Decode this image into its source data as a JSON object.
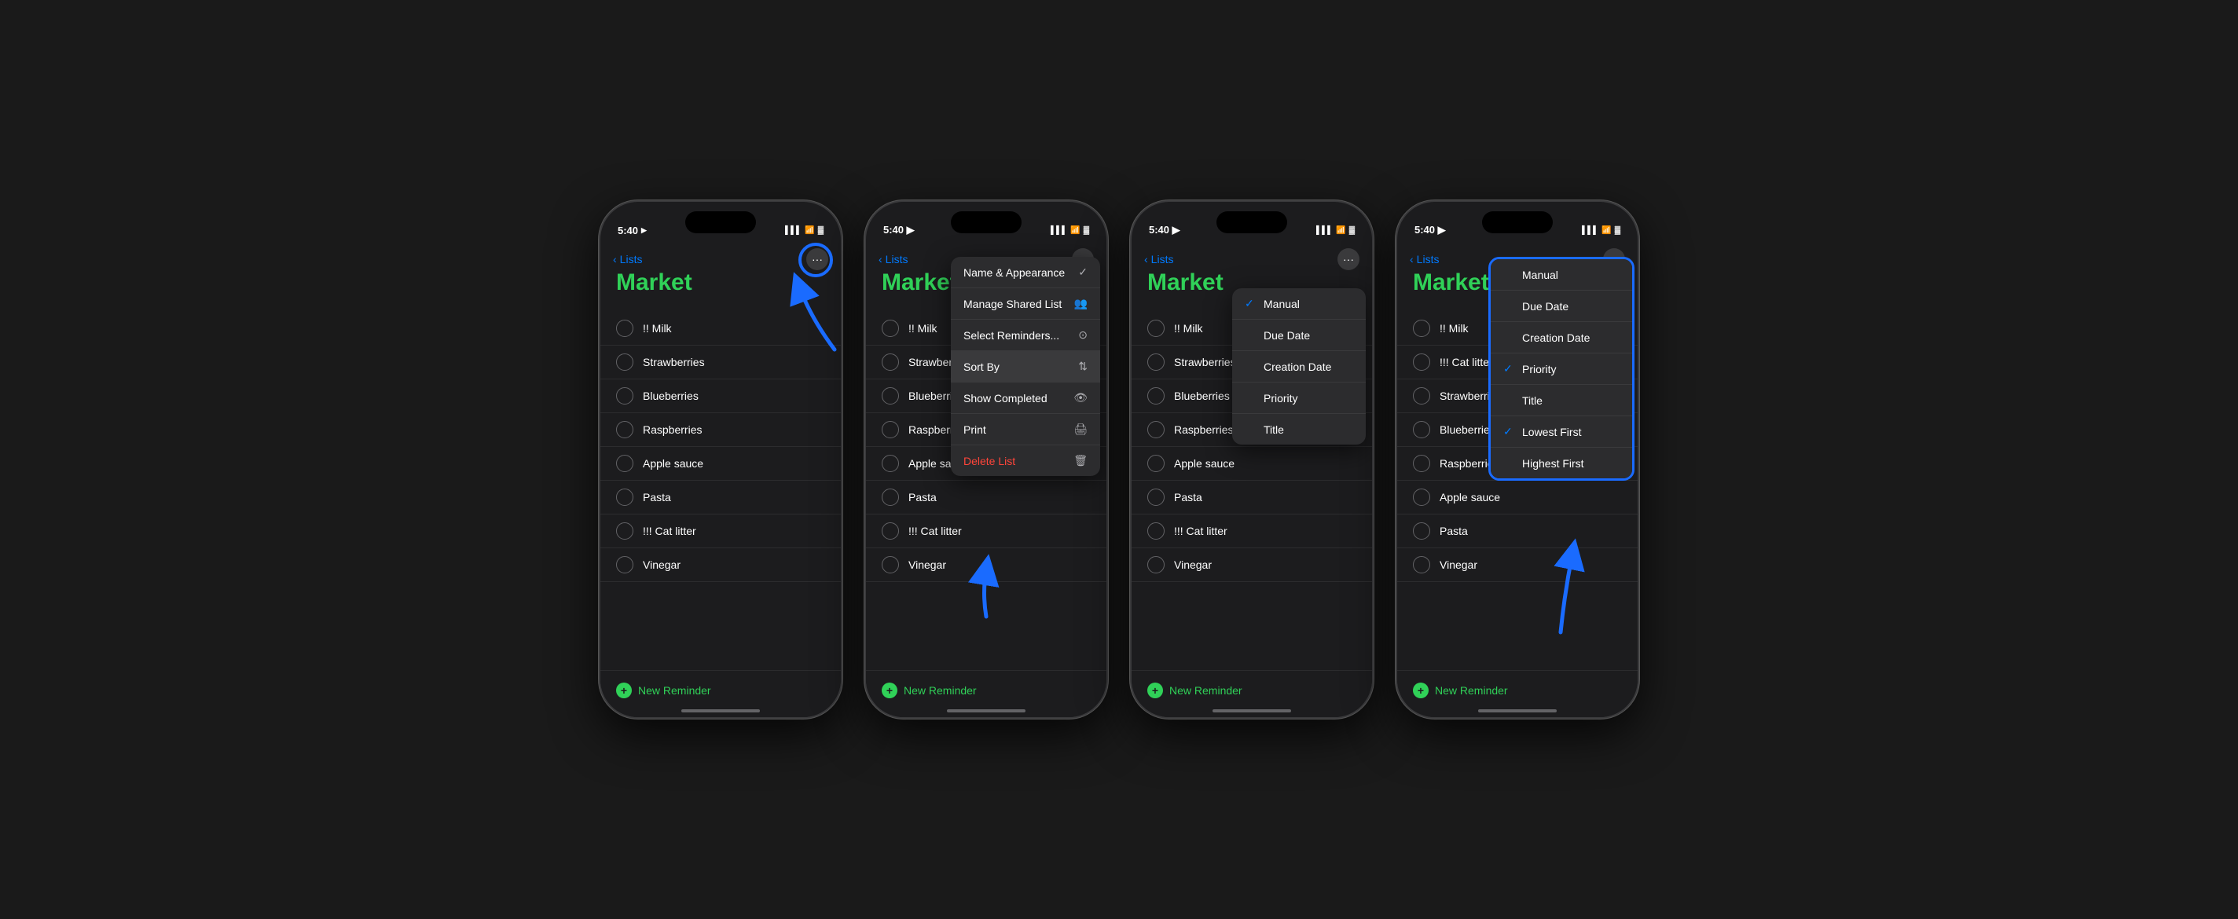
{
  "status": {
    "time": "5:40",
    "nav_arrow": "▶",
    "signal_bars": "▌▌▌",
    "wifi": "WiFi",
    "battery": "🔋"
  },
  "phones": [
    {
      "id": "phone1",
      "title": "Market",
      "nav_back": "Lists",
      "items": [
        "!! Milk",
        "Strawberries",
        "Blueberries",
        "Raspberries",
        "Apple sauce",
        "Pasta",
        "!!! Cat litter",
        "Vinegar"
      ],
      "new_reminder": "New Reminder",
      "showHighlight": true
    },
    {
      "id": "phone2",
      "title": "Market",
      "nav_back": "Lists",
      "items": [
        "!! Milk",
        "Strawberries",
        "Blueberries",
        "Raspberries",
        "Apple sauce",
        "Pasta",
        "!!! Cat litter",
        "Vinegar"
      ],
      "new_reminder": "New Reminder",
      "menu": [
        {
          "label": "Name & Appearance",
          "icon": "✓"
        },
        {
          "label": "Manage Shared List",
          "icon": "👥"
        },
        {
          "label": "Select Reminders...",
          "icon": "⊙"
        },
        {
          "label": "Sort By",
          "icon": "⇅",
          "highlighted": true
        },
        {
          "label": "Show Completed",
          "icon": "👁"
        },
        {
          "label": "Print",
          "icon": "🖨"
        },
        {
          "label": "Delete List",
          "icon": "🗑",
          "destructive": true
        }
      ]
    },
    {
      "id": "phone3",
      "title": "Market",
      "nav_back": "Lists",
      "items": [
        "!! Milk",
        "Strawberries",
        "Blueberries",
        "Raspberries",
        "Apple sauce",
        "Pasta",
        "!!! Cat litter",
        "Vinegar"
      ],
      "new_reminder": "New Reminder",
      "sortMenu": [
        {
          "label": "Manual",
          "checked": true
        },
        {
          "label": "Due Date",
          "checked": false
        },
        {
          "label": "Creation Date",
          "checked": false
        },
        {
          "label": "Priority",
          "checked": false
        },
        {
          "label": "Title",
          "checked": false
        }
      ]
    },
    {
      "id": "phone4",
      "title": "Market",
      "nav_back": "Lists",
      "items": [
        "!! Milk",
        "!!! Cat litte",
        "Strawberries",
        "Blueberries",
        "Raspberries",
        "Apple sauce",
        "Pasta",
        "Vinegar"
      ],
      "new_reminder": "New Reminder",
      "sortMenu2": [
        {
          "label": "Manual",
          "checked": false
        },
        {
          "label": "Due Date",
          "checked": false
        },
        {
          "label": "Creation Date",
          "checked": false
        },
        {
          "label": "Priority",
          "checked": true
        },
        {
          "label": "Title",
          "checked": false
        },
        {
          "label": "Lowest First",
          "checked": true
        },
        {
          "label": "Highest First",
          "checked": false
        }
      ]
    }
  ],
  "labels": {
    "new_reminder": "New Reminder",
    "lists_back": "Lists"
  }
}
